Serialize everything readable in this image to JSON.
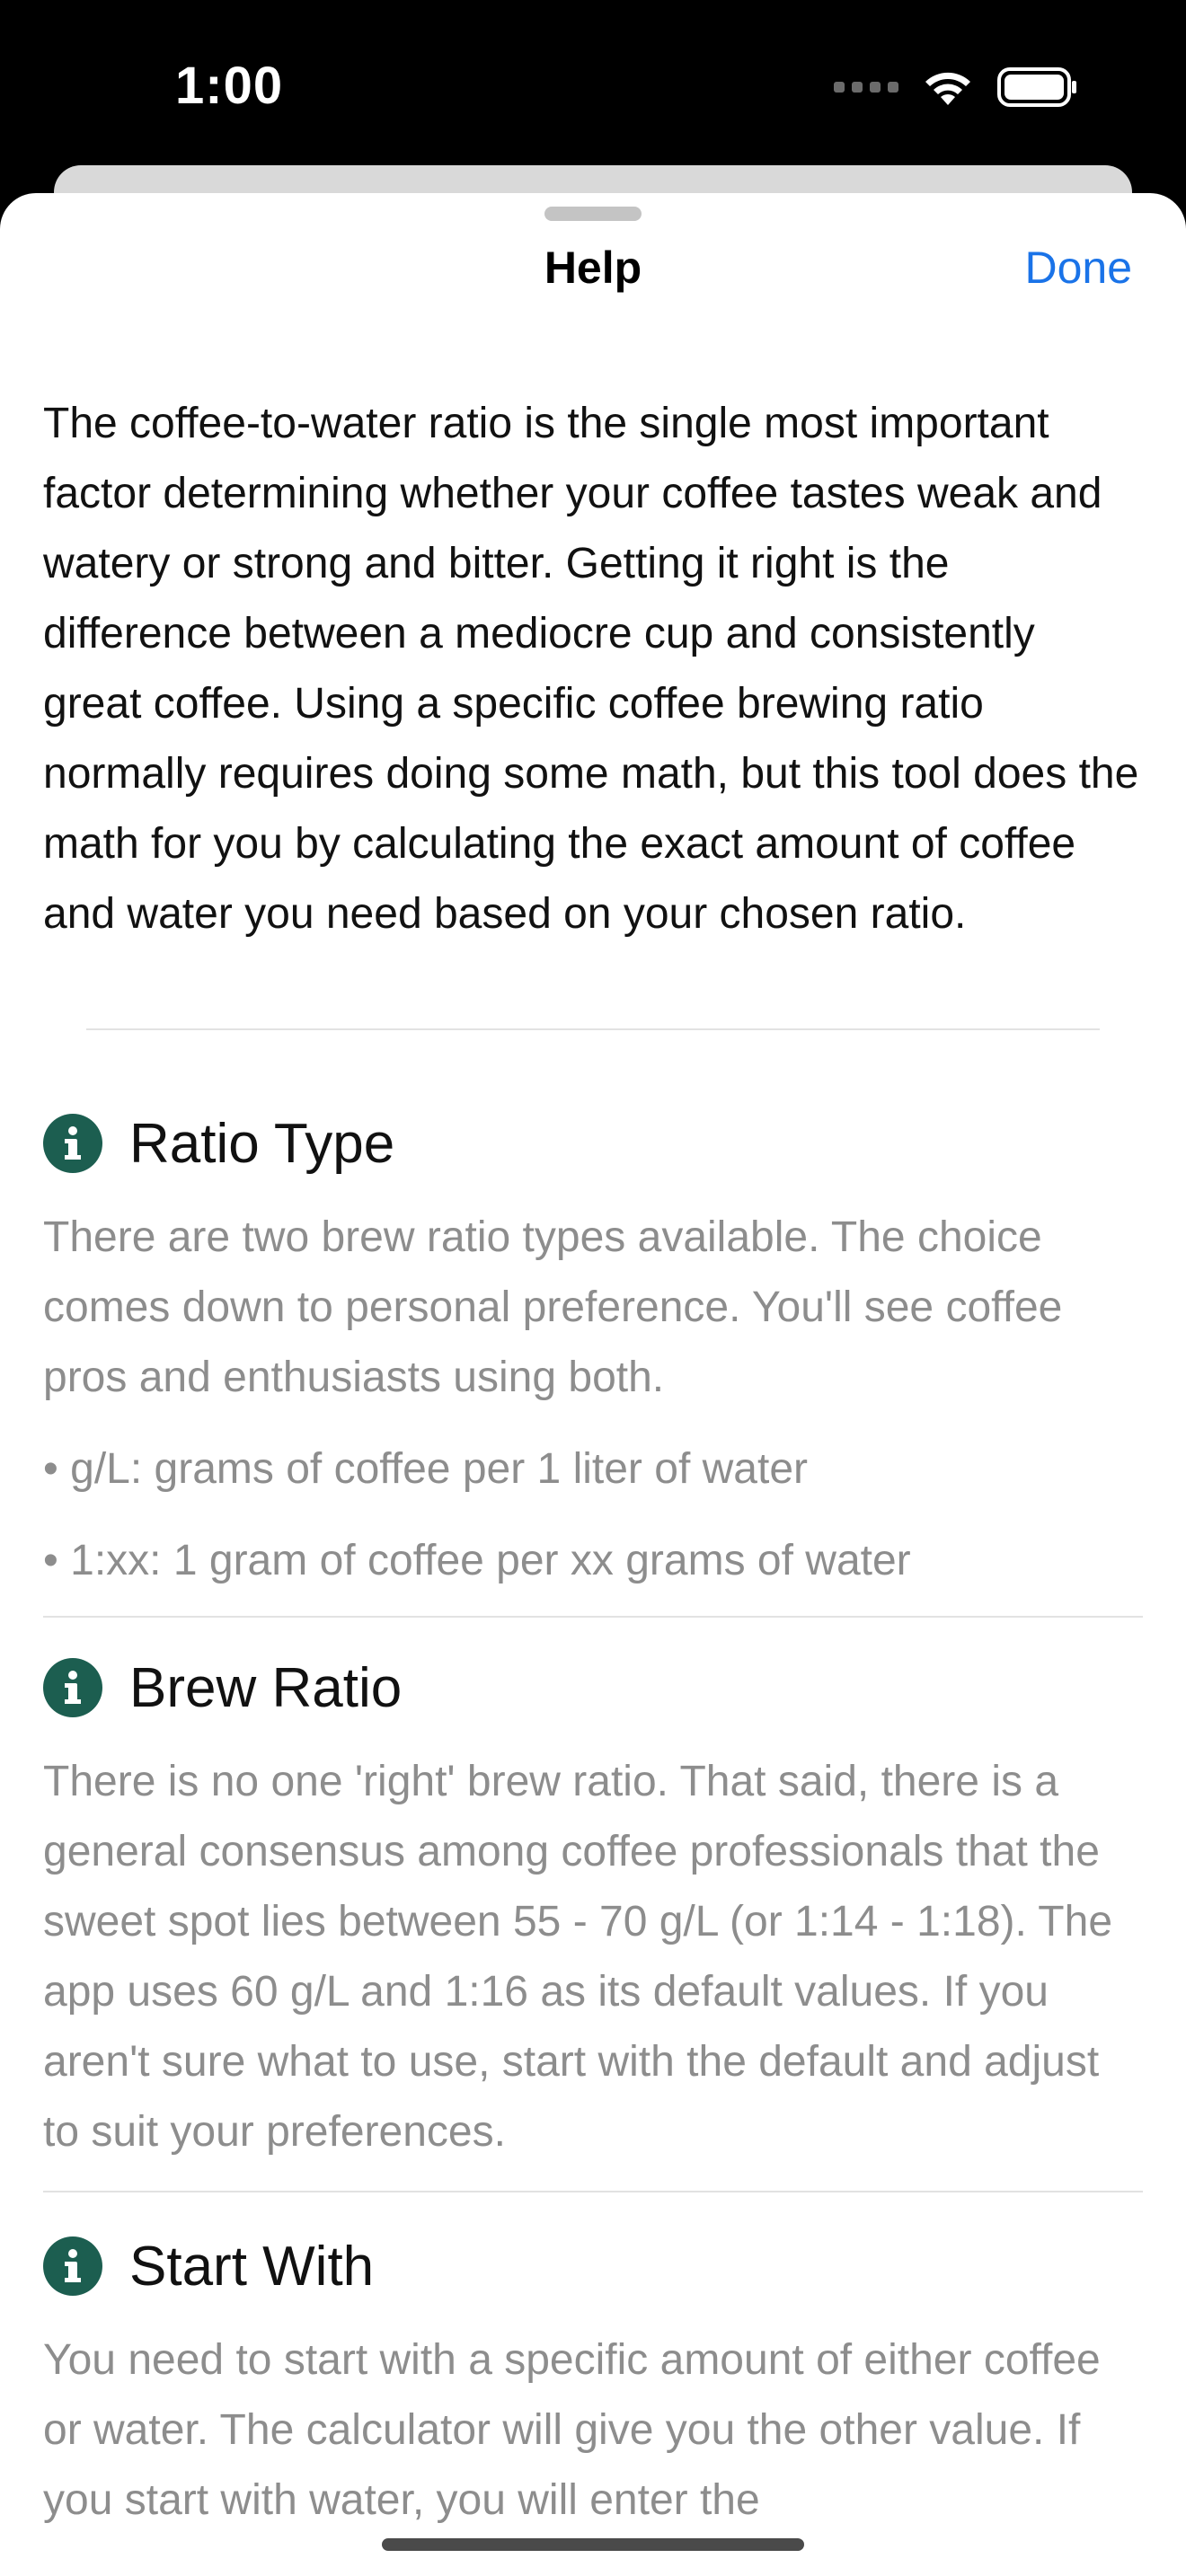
{
  "status_bar": {
    "time": "1:00"
  },
  "sheet": {
    "title": "Help",
    "done_label": "Done",
    "intro": "The coffee-to-water ratio is the single most important factor determining whether your coffee tastes weak and watery or strong and bitter. Getting it right is the difference between a mediocre cup and consistently great coffee. Using a specific coffee brewing ratio normally requires doing some math, but this tool does the math for you by calculating the exact amount of coffee and water you need based on your chosen ratio."
  },
  "sections": [
    {
      "title": "Ratio Type",
      "body": "There are two brew ratio types available. The choice comes down to personal preference. You'll see coffee pros and enthusiasts using both.",
      "bullets": [
        "• g/L: grams of coffee per 1 liter of water",
        "• 1:xx: 1 gram of coffee per xx grams of water"
      ]
    },
    {
      "title": "Brew Ratio",
      "body": "There is no one 'right' brew ratio. That said, there is a general consensus among coffee professionals that the sweet spot lies between 55 - 70 g/L (or 1:14 - 1:18). The app uses 60 g/L and 1:16 as its default values. If you aren't sure what to use, start with the default and adjust to suit your preferences."
    },
    {
      "title": "Start With",
      "body": "You need to start with a specific amount of either coffee or water. The calculator will give you the other value. If you start with water, you will enter the"
    }
  ],
  "colors": {
    "accent": "#1a73e8",
    "info_icon": "#1c5e50",
    "secondary_text": "#8d8d8d"
  },
  "icons": [
    "wifi-icon",
    "battery-icon",
    "info-icon"
  ]
}
